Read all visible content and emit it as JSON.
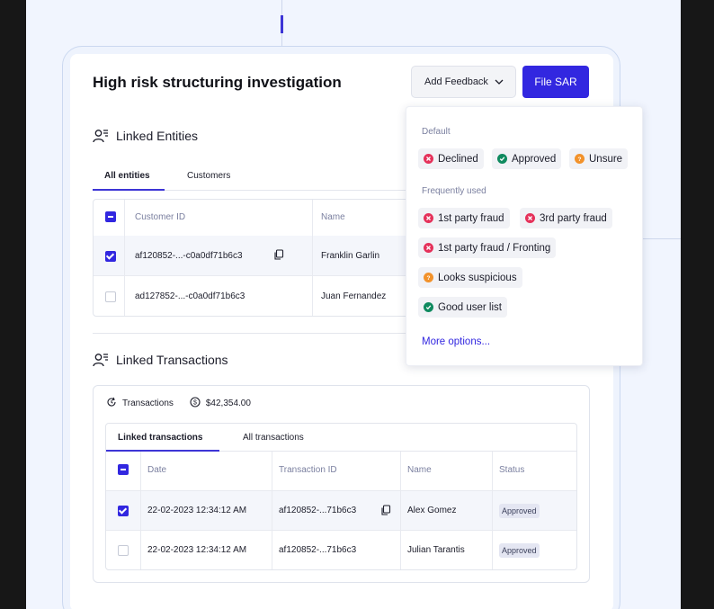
{
  "case": {
    "title": "High risk structuring investigation",
    "add_feedback_label": "Add Feedback",
    "file_sar_label": "File SAR"
  },
  "linked_entities": {
    "heading": "Linked Entities",
    "tabs": [
      {
        "label": "All entities",
        "active": true
      },
      {
        "label": "Customers",
        "active": false
      }
    ],
    "columns": [
      "Customer ID",
      "Name"
    ],
    "rows": [
      {
        "customer_id": "af120852-...-c0a0df71b6c3",
        "name": "Franklin Garlin",
        "selected": true
      },
      {
        "customer_id": "ad127852-...-c0a0df71b6c3",
        "name": "Juan Fernandez",
        "selected": false
      }
    ]
  },
  "linked_transactions": {
    "heading": "Linked Transactions",
    "transactions_label": "Transactions",
    "total_amount": "$42,354.00",
    "tabs": [
      {
        "label": "Linked transactions",
        "active": true
      },
      {
        "label": "All transactions",
        "active": false
      }
    ],
    "columns": [
      "Date",
      "Transaction ID",
      "Name",
      "Status"
    ],
    "rows": [
      {
        "date": "22-02-2023  12:34:12 AM",
        "transaction_id": "af120852-...71b6c3",
        "name": "Alex Gomez",
        "status": "Approved",
        "selected": true
      },
      {
        "date": "22-02-2023  12:34:12 AM",
        "transaction_id": "af120852-...71b6c3",
        "name": "Julian Tarantis",
        "status": "Approved",
        "selected": false
      }
    ]
  },
  "feedback_menu": {
    "default_label": "Default",
    "default_options": [
      {
        "label": "Declined",
        "kind": "declined"
      },
      {
        "label": "Approved",
        "kind": "approved"
      },
      {
        "label": "Unsure",
        "kind": "unsure"
      }
    ],
    "frequent_label": "Frequently used",
    "frequent_options": [
      {
        "label": "1st party fraud",
        "kind": "declined"
      },
      {
        "label": "3rd party fraud",
        "kind": "declined"
      },
      {
        "label": "1st party fraud / Fronting",
        "kind": "declined"
      },
      {
        "label": "Looks suspicious",
        "kind": "unsure"
      },
      {
        "label": "Good user list",
        "kind": "approved"
      }
    ],
    "more_options_label": "More options..."
  },
  "colors": {
    "accent": "#3227e0",
    "declined": "#e5315a",
    "approved": "#0f8a5f",
    "unsure": "#f2922b"
  },
  "icons": {
    "entities": "user-list-icon",
    "transactions_refresh": "refresh-icon",
    "amount": "dollar-circle-icon",
    "copy": "copy-icon",
    "dropdown": "chevron-down-icon"
  }
}
